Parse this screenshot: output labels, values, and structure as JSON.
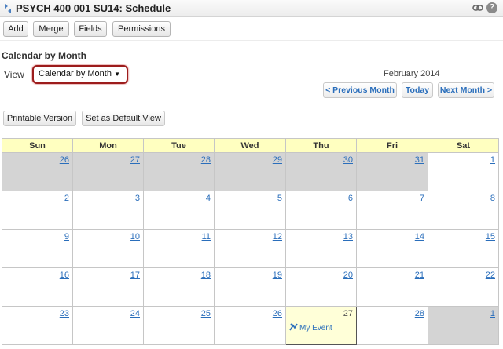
{
  "titlebar": {
    "title": "PSYCH 400 001 SU14: Schedule",
    "help_glyph": "?"
  },
  "toolbar": {
    "add": "Add",
    "merge": "Merge",
    "fields": "Fields",
    "permissions": "Permissions"
  },
  "section_title": "Calendar by Month",
  "view": {
    "label": "View",
    "selected": "Calendar by Month",
    "arrow": "▼"
  },
  "month_label": "February 2014",
  "nav": {
    "prev": "< Previous Month",
    "today": "Today",
    "next": "Next Month >"
  },
  "actions": {
    "printable": "Printable Version",
    "default_view": "Set as Default View"
  },
  "calendar": {
    "days": [
      "Sun",
      "Mon",
      "Tue",
      "Wed",
      "Thu",
      "Fri",
      "Sat"
    ],
    "weeks": [
      [
        {
          "d": "26",
          "other": true
        },
        {
          "d": "27",
          "other": true
        },
        {
          "d": "28",
          "other": true
        },
        {
          "d": "29",
          "other": true
        },
        {
          "d": "30",
          "other": true
        },
        {
          "d": "31",
          "other": true
        },
        {
          "d": "1",
          "other": false
        }
      ],
      [
        {
          "d": "2"
        },
        {
          "d": "3"
        },
        {
          "d": "4"
        },
        {
          "d": "5"
        },
        {
          "d": "6"
        },
        {
          "d": "7"
        },
        {
          "d": "8"
        }
      ],
      [
        {
          "d": "9"
        },
        {
          "d": "10"
        },
        {
          "d": "11"
        },
        {
          "d": "12"
        },
        {
          "d": "13"
        },
        {
          "d": "14"
        },
        {
          "d": "15"
        }
      ],
      [
        {
          "d": "16"
        },
        {
          "d": "17"
        },
        {
          "d": "18"
        },
        {
          "d": "19"
        },
        {
          "d": "20"
        },
        {
          "d": "21"
        },
        {
          "d": "22"
        }
      ],
      [
        {
          "d": "23"
        },
        {
          "d": "24"
        },
        {
          "d": "25"
        },
        {
          "d": "26"
        },
        {
          "d": "27",
          "today": true,
          "event": "My Event"
        },
        {
          "d": "28"
        },
        {
          "d": "1",
          "other": true
        }
      ]
    ]
  },
  "colors": {
    "link": "#2a6ebb",
    "header_bg": "#ffffc0",
    "other_month_bg": "#d4d4d4",
    "highlight_border": "#9c1c1c"
  }
}
